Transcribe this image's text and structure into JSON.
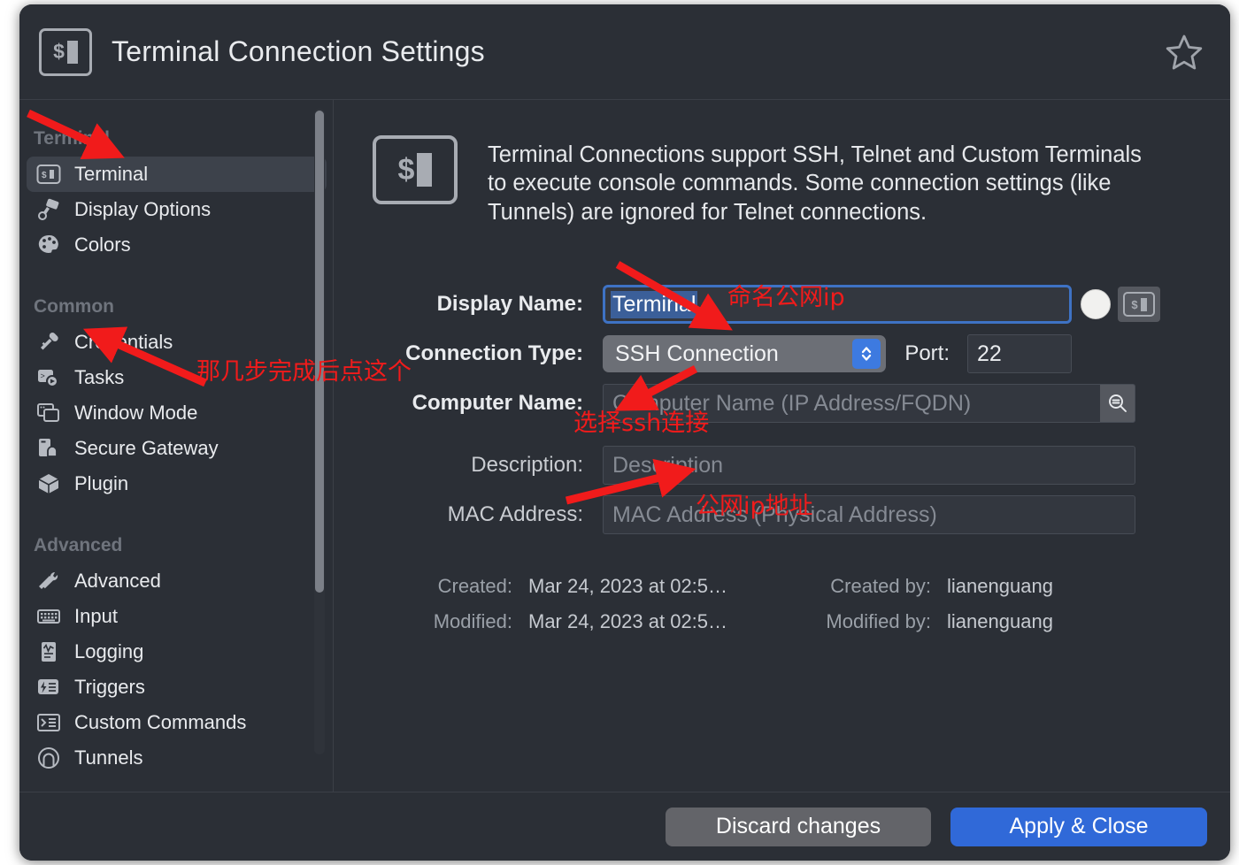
{
  "window": {
    "title": "Terminal Connection Settings",
    "title_icon": "terminal-icon",
    "favorite_icon": "star-icon"
  },
  "sidebar": {
    "groups": [
      {
        "label": "Terminal",
        "items": [
          {
            "label": "Terminal",
            "icon": "terminal-icon",
            "selected": true
          },
          {
            "label": "Display Options",
            "icon": "paint-roller-icon",
            "selected": false
          },
          {
            "label": "Colors",
            "icon": "palette-icon",
            "selected": false
          }
        ]
      },
      {
        "label": "Common",
        "items": [
          {
            "label": "Credentials",
            "icon": "key-icon",
            "selected": false
          },
          {
            "label": "Tasks",
            "icon": "tasks-icon",
            "selected": false
          },
          {
            "label": "Window Mode",
            "icon": "windows-icon",
            "selected": false
          },
          {
            "label": "Secure Gateway",
            "icon": "gateway-icon",
            "selected": false
          },
          {
            "label": "Plugin",
            "icon": "cube-icon",
            "selected": false
          }
        ]
      },
      {
        "label": "Advanced",
        "items": [
          {
            "label": "Advanced",
            "icon": "tools-icon",
            "selected": false
          },
          {
            "label": "Input",
            "icon": "keyboard-icon",
            "selected": false
          },
          {
            "label": "Logging",
            "icon": "log-icon",
            "selected": false
          },
          {
            "label": "Triggers",
            "icon": "trigger-icon",
            "selected": false
          },
          {
            "label": "Custom Commands",
            "icon": "command-prompt-icon",
            "selected": false
          },
          {
            "label": "Tunnels",
            "icon": "tunnel-icon",
            "selected": false
          }
        ]
      }
    ]
  },
  "main": {
    "description": "Terminal Connections support SSH, Telnet and Custom Terminals to execute console commands. Some connection settings (like Tunnels) are ignored for Telnet connections.",
    "description_icon": "terminal-icon",
    "fields": {
      "display_name": {
        "label": "Display Name:",
        "value": "Terminal",
        "selected": true,
        "circle_button": "color-swatch-button",
        "side_button_icon": "terminal-icon"
      },
      "connection_type": {
        "label": "Connection Type:",
        "value": "SSH Connection",
        "options": [
          "SSH Connection"
        ],
        "stepper_icon": "chevron-up-down-icon"
      },
      "port": {
        "label": "Port:",
        "value": "22"
      },
      "computer_name": {
        "label": "Computer Name:",
        "value": "",
        "placeholder": "Computer Name (IP Address/FQDN)",
        "search_icon": "search-list-icon"
      },
      "description": {
        "label": "Description:",
        "value": "",
        "placeholder": "Description"
      },
      "mac_address": {
        "label": "MAC Address:",
        "value": "",
        "placeholder": "MAC Address (Physical Address)"
      }
    },
    "meta": {
      "created_key": "Created:",
      "created_value": "Mar 24, 2023 at 02:5…",
      "modified_key": "Modified:",
      "modified_value": "Mar 24, 2023 at 02:5…",
      "created_by_key": "Created by:",
      "created_by_value": "lianenguang",
      "modified_by_key": "Modified by:",
      "modified_by_value": "lianenguang"
    }
  },
  "footer": {
    "discard_label": "Discard changes",
    "apply_label": "Apply & Close"
  },
  "annotations": {
    "color": "#f11b1b",
    "notes": [
      {
        "text": "命名公网ip",
        "target": "display-name-field"
      },
      {
        "text": "那几步完成后点这个",
        "target": "sidebar-item-credentials"
      },
      {
        "text": "选择ssh连接",
        "target": "connection-type-select"
      },
      {
        "text": "公网ip地址",
        "target": "computer-name-field"
      }
    ]
  }
}
